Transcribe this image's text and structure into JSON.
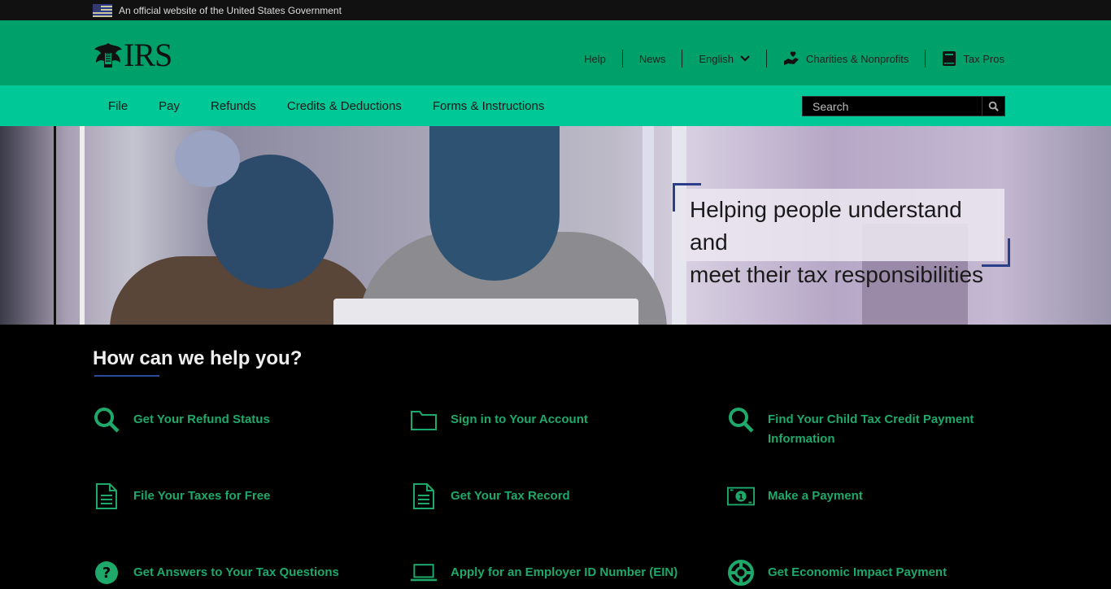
{
  "gov_banner": {
    "text": "An official website of the United States Government"
  },
  "header": {
    "logo_text": "IRS",
    "utility": {
      "help": "Help",
      "news": "News",
      "language": "English",
      "charities": "Charities & Nonprofits",
      "tax_pros": "Tax Pros"
    }
  },
  "nav": {
    "items": [
      "File",
      "Pay",
      "Refunds",
      "Credits & Deductions",
      "Forms & Instructions"
    ],
    "search_placeholder": "Search"
  },
  "hero": {
    "headline_line1": "Helping people understand and",
    "headline_line2": "meet their tax responsibilities"
  },
  "help": {
    "title": "How can we help you?",
    "links": [
      {
        "label": "Get Your Refund Status",
        "icon": "search-icon"
      },
      {
        "label": "Sign in to Your Account",
        "icon": "folder-icon"
      },
      {
        "label": "Find Your Child Tax Credit Payment Information",
        "icon": "search-icon"
      },
      {
        "label": "File Your Taxes for Free",
        "icon": "document-icon"
      },
      {
        "label": "Get Your Tax Record",
        "icon": "document-icon"
      },
      {
        "label": "Make a Payment",
        "icon": "money-icon"
      },
      {
        "label": "Get Answers to Your Tax Questions",
        "icon": "question-icon"
      },
      {
        "label": "Apply for an Employer ID Number (EIN)",
        "icon": "laptop-icon"
      },
      {
        "label": "Get Economic Impact Payment",
        "icon": "lifebuoy-icon"
      }
    ]
  },
  "colors": {
    "header_green": "#00a06a",
    "nav_green": "#00c896",
    "link_green": "#1ea86a",
    "accent_blue": "#2a3f8a"
  }
}
